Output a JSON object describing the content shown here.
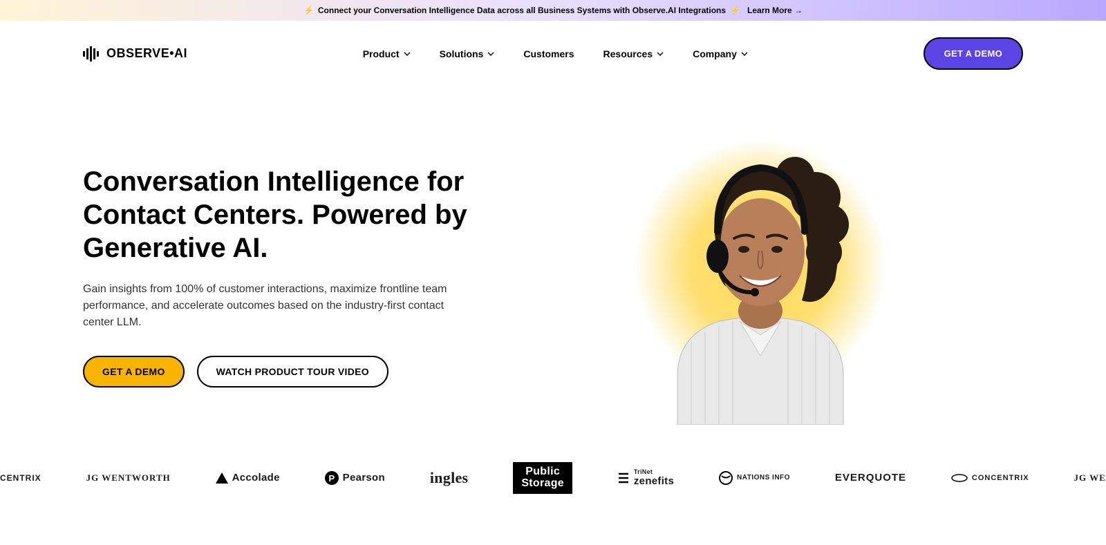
{
  "announcement": {
    "text": "Connect your Conversation Intelligence Data across all Business Systems with Observe.AI Integrations",
    "cta": "Learn More →"
  },
  "logo_text": "OBSERVE•AI",
  "nav": {
    "items": [
      {
        "label": "Product",
        "dropdown": true
      },
      {
        "label": "Solutions",
        "dropdown": true
      },
      {
        "label": "Customers",
        "dropdown": false
      },
      {
        "label": "Resources",
        "dropdown": true
      },
      {
        "label": "Company",
        "dropdown": true
      }
    ],
    "demo_label": "GET A DEMO"
  },
  "hero": {
    "title": "Conversation Intelligence for Contact Centers. Powered by Generative AI.",
    "desc": "Gain insights from 100% of customer interactions, maximize frontline team performance, and accelerate outcomes based on the industry-first contact center LLM.",
    "primary_cta": "GET A DEMO",
    "secondary_cta": "WATCH PRODUCT TOUR VIDEO"
  },
  "clients": [
    "CENTRIX",
    "JG WENTWORTH",
    "Accolade",
    "Pearson",
    "ingles",
    "Public Storage",
    "TriNet zenefits",
    "NATIONS INFO",
    "EVERQUOTE",
    "CONCENTRIX",
    "JG WE"
  ]
}
